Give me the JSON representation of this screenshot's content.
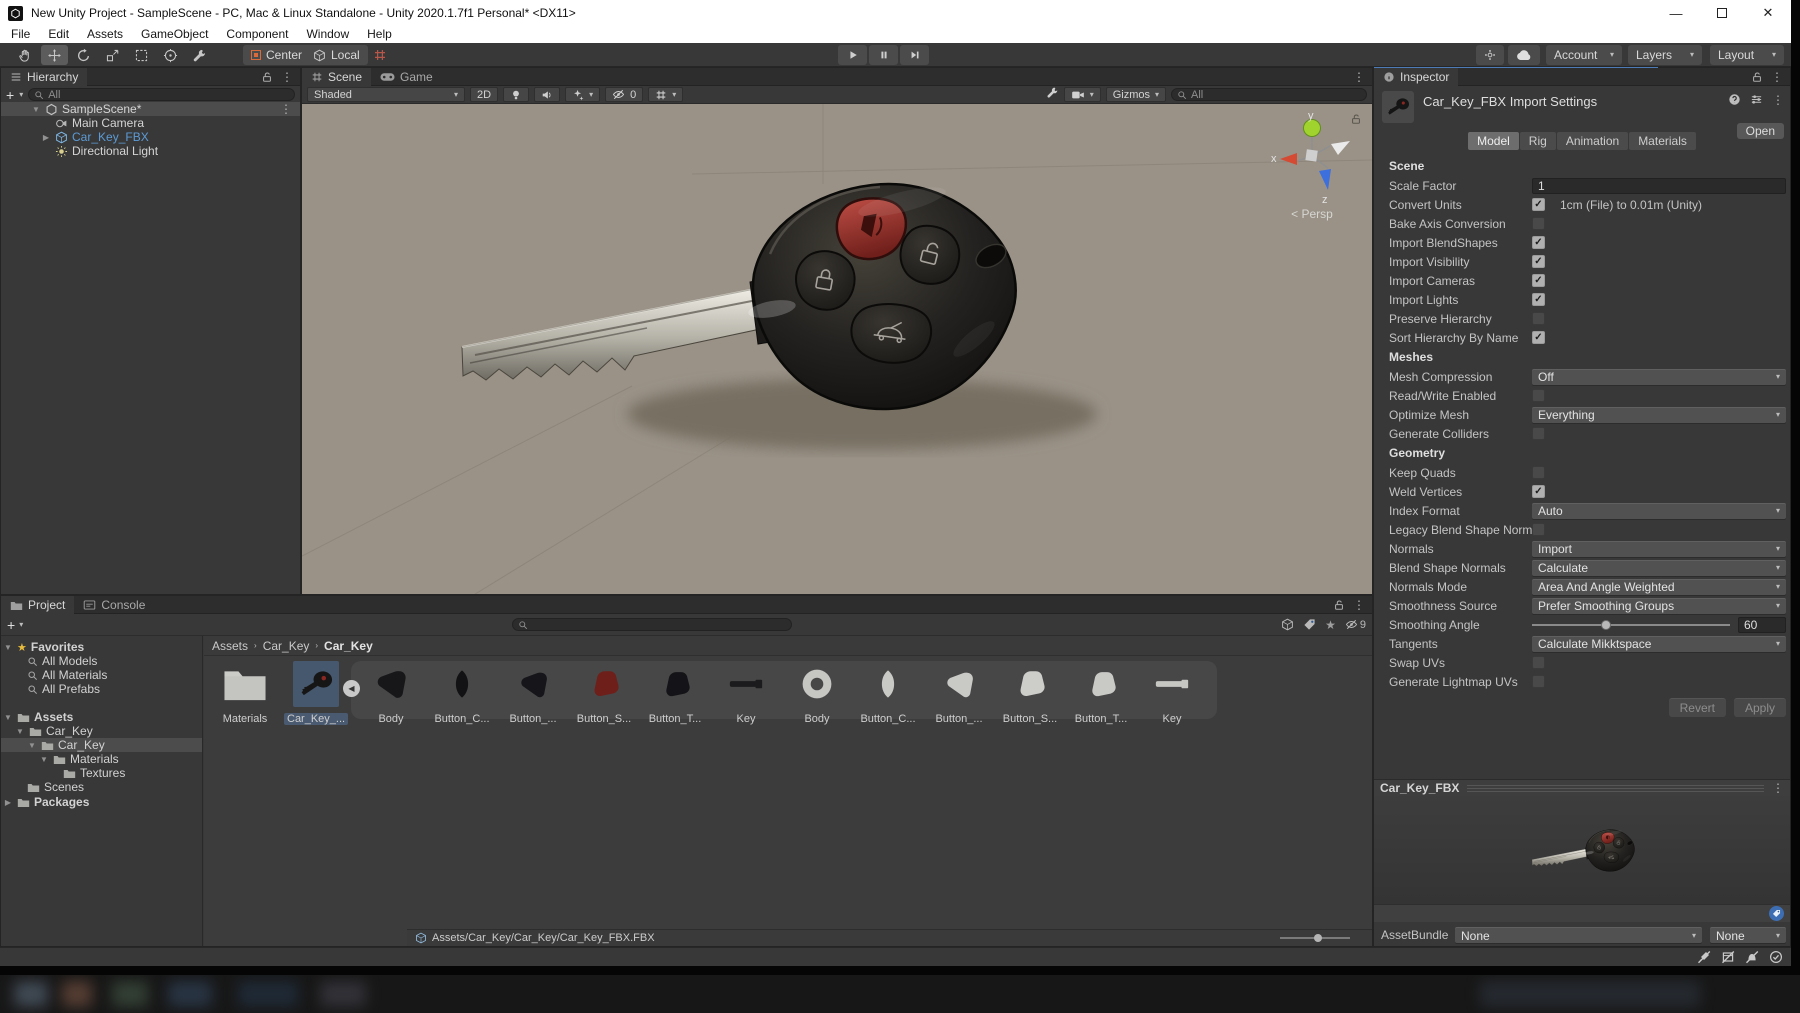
{
  "window": {
    "title": "New Unity Project - SampleScene - PC, Mac & Linux Standalone - Unity 2020.1.7f1 Personal* <DX11>"
  },
  "menu": {
    "items": [
      "File",
      "Edit",
      "Assets",
      "GameObject",
      "Component",
      "Window",
      "Help"
    ]
  },
  "toolbar": {
    "pivot": "Center",
    "orientation": "Local",
    "account": "Account",
    "layers": "Layers",
    "layout": "Layout"
  },
  "hierarchy": {
    "tab": "Hierarchy",
    "search": "All",
    "scene_row": "SampleScene*",
    "rows": [
      {
        "label": "Main Camera"
      },
      {
        "label": "Car_Key_FBX"
      },
      {
        "label": "Directional Light"
      }
    ]
  },
  "scene": {
    "tab_scene": "Scene",
    "tab_game": "Game",
    "draw_mode": "Shaded",
    "toggle_2d": "2D",
    "hidden_count": "0",
    "gizmos": "Gizmos",
    "search": "All",
    "axis": {
      "x": "x",
      "y": "y",
      "z": "z"
    },
    "projection": "Persp"
  },
  "inspector": {
    "tab": "Inspector",
    "title": "Car_Key_FBX Import Settings",
    "open": "Open",
    "tabs": [
      "Model",
      "Rig",
      "Animation",
      "Materials"
    ],
    "rows": [
      {
        "type": "header",
        "label": "Scene"
      },
      {
        "type": "text",
        "label": "Scale Factor",
        "value": "1"
      },
      {
        "type": "toggle",
        "label": "Convert Units",
        "checked": true,
        "note": "1cm (File) to 0.01m (Unity)"
      },
      {
        "type": "toggle",
        "label": "Bake Axis Conversion",
        "checked": false
      },
      {
        "type": "toggle",
        "label": "Import BlendShapes",
        "checked": true
      },
      {
        "type": "toggle",
        "label": "Import Visibility",
        "checked": true
      },
      {
        "type": "toggle",
        "label": "Import Cameras",
        "checked": true
      },
      {
        "type": "toggle",
        "label": "Import Lights",
        "checked": true
      },
      {
        "type": "toggle",
        "label": "Preserve Hierarchy",
        "checked": false
      },
      {
        "type": "toggle",
        "label": "Sort Hierarchy By Name",
        "checked": true
      },
      {
        "type": "header",
        "label": "Meshes"
      },
      {
        "type": "dropdown",
        "label": "Mesh Compression",
        "value": "Off"
      },
      {
        "type": "toggle",
        "label": "Read/Write Enabled",
        "checked": false
      },
      {
        "type": "dropdown",
        "label": "Optimize Mesh",
        "value": "Everything"
      },
      {
        "type": "toggle",
        "label": "Generate Colliders",
        "checked": false
      },
      {
        "type": "header",
        "label": "Geometry"
      },
      {
        "type": "toggle",
        "label": "Keep Quads",
        "checked": false
      },
      {
        "type": "toggle",
        "label": "Weld Vertices",
        "checked": true
      },
      {
        "type": "dropdown",
        "label": "Index Format",
        "value": "Auto"
      },
      {
        "type": "toggle",
        "label": "Legacy Blend Shape Normals",
        "checked": false
      },
      {
        "type": "dropdown",
        "label": "Normals",
        "value": "Import"
      },
      {
        "type": "dropdown",
        "label": "Blend Shape Normals",
        "value": "Calculate"
      },
      {
        "type": "dropdown",
        "label": "Normals Mode",
        "value": "Area And Angle Weighted"
      },
      {
        "type": "dropdown",
        "label": "Smoothness Source",
        "value": "Prefer Smoothing Groups"
      },
      {
        "type": "slider",
        "label": "Smoothing Angle",
        "value": "60"
      },
      {
        "type": "dropdown",
        "label": "Tangents",
        "value": "Calculate Mikktspace"
      },
      {
        "type": "toggle",
        "label": "Swap UVs",
        "checked": false
      },
      {
        "type": "toggle",
        "label": "Generate Lightmap UVs",
        "checked": false
      }
    ],
    "revert": "Revert",
    "apply": "Apply",
    "preview_title": "Car_Key_FBX",
    "asset_bundle": {
      "label": "AssetBundle",
      "bundle": "None",
      "variant": "None"
    }
  },
  "project": {
    "tab_project": "Project",
    "tab_console": "Console",
    "hidden_count": "9",
    "tree": [
      {
        "label": "Favorites"
      },
      {
        "label": "All Models"
      },
      {
        "label": "All Materials"
      },
      {
        "label": "All Prefabs"
      },
      {
        "label": "Assets"
      },
      {
        "label": "Car_Key"
      },
      {
        "label": "Car_Key"
      },
      {
        "label": "Materials"
      },
      {
        "label": "Textures"
      },
      {
        "label": "Scenes"
      },
      {
        "label": "Packages"
      }
    ],
    "breadcrumb": [
      "Assets",
      "Car_Key",
      "Car_Key"
    ],
    "assets": [
      {
        "label": "Materials"
      },
      {
        "label": "Car_Key_..."
      },
      {
        "label": "Body"
      },
      {
        "label": "Button_C..."
      },
      {
        "label": "Button_..."
      },
      {
        "label": "Button_S..."
      },
      {
        "label": "Button_T..."
      },
      {
        "label": "Key"
      },
      {
        "label": "Body"
      },
      {
        "label": "Button_C..."
      },
      {
        "label": "Button_..."
      },
      {
        "label": "Button_S..."
      },
      {
        "label": "Button_T..."
      },
      {
        "label": "Key"
      }
    ],
    "footer_path": "Assets/Car_Key/Car_Key/Car_Key_FBX.FBX"
  }
}
